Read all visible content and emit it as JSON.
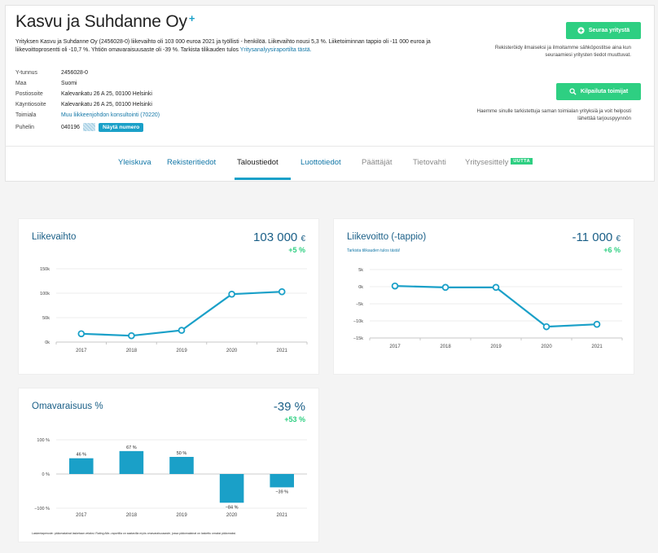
{
  "company": {
    "name": "Kasvu ja Suhdanne Oy",
    "favorite_symbol": "+",
    "description_before_link": "Yrityksen Kasvu ja Suhdanne Oy (2456028-0) liikevaihto oli 103 000 euroa 2021 ja työllisti - henkilöä. Liikevaihto nousi 5,3 %. Liiketoiminnan tappio oli -11 000 euroa ja liikevoittoprosentti oli -10,7 %. Yhtiön omavaraisuusaste oli -39 %. Tarkista tilikauden tulos ",
    "description_link": "Yritysanalyysiraportilta tästä."
  },
  "info": {
    "rows": [
      {
        "key": "Y-tunnus",
        "value": "2456028-0"
      },
      {
        "key": "Maa",
        "value": "Suomi"
      },
      {
        "key": "Postiosoite",
        "value": "Kalevankatu 26 A 25, 00100 Helsinki"
      },
      {
        "key": "Käyntiosoite",
        "value": "Kalevankatu 26 A 25, 00100 Helsinki"
      },
      {
        "key": "Toimiala",
        "value": "Muu liikkeenjohdon konsultointi (70220)"
      }
    ],
    "phone_key": "Puhelin",
    "phone_prefix": "040196",
    "show_number_label": "Näytä numero"
  },
  "actions": {
    "follow_label": "Seuraa yritystä",
    "follow_note": "Rekisteröidy ilmaiseksi ja ilmoitamme sähköpostitse aina kun seuraamiesi yritysten tiedot muuttuvat.",
    "compete_label": "Kilpailuta toimijat",
    "compete_note": "Haemme sinulle tarkistettuja saman toimialan yrityksiä ja voit helposti lähettää tarjouspyynnön"
  },
  "tabs": [
    {
      "label": "Yleiskuva",
      "style": "a"
    },
    {
      "label": "Rekisteritiedot",
      "style": "a"
    },
    {
      "label": "Taloustiedot",
      "style": "active"
    },
    {
      "label": "Luottotiedot",
      "style": "a"
    },
    {
      "label": "Päättäjät",
      "style": "g"
    },
    {
      "label": "Tietovahti",
      "style": "g"
    },
    {
      "label": "Yritysesittely",
      "style": "g"
    }
  ],
  "tab_badge": "UUTTA",
  "colors": {
    "accent": "#1aa0c8",
    "green": "#2ecf82",
    "title_blue": "#1a5f87"
  },
  "chart_data": [
    {
      "type": "line",
      "title": "Liikevaihto",
      "headline_value": "103 000",
      "unit": "€",
      "change": "+5 %",
      "x": [
        "2017",
        "2018",
        "2019",
        "2020",
        "2021"
      ],
      "values": [
        17000,
        13000,
        24000,
        98000,
        103000
      ],
      "ylim": [
        0,
        150000
      ],
      "yticks": [
        0,
        50000,
        100000,
        150000
      ],
      "ytick_labels": [
        "0k",
        "50k",
        "100k",
        "150k"
      ],
      "grid": true
    },
    {
      "type": "line",
      "title": "Liikevoitto (-tappio)",
      "subtitle": "Tarkista tilikauden tulos tästä!",
      "headline_value": "-11 000",
      "unit": "€",
      "change": "+6 %",
      "x": [
        "2017",
        "2018",
        "2019",
        "2020",
        "2021"
      ],
      "values": [
        200,
        -200,
        -200,
        -11700,
        -11000
      ],
      "ylim": [
        -15000,
        5000
      ],
      "yticks": [
        5000,
        0,
        -5000,
        -10000,
        -15000
      ],
      "ytick_labels": [
        "5k",
        "0k",
        "−5k",
        "−10k",
        "−15k"
      ],
      "grid": true
    },
    {
      "type": "bar",
      "title": "Omavaraisuus %",
      "headline_value": "-39 %",
      "change": "+53 %",
      "categories": [
        "2017",
        "2018",
        "2019",
        "2020",
        "2021"
      ],
      "values": [
        46,
        67,
        50,
        -84,
        -39
      ],
      "data_labels": [
        "46 %",
        "67 %",
        "50 %",
        "−84 %",
        "−39 %"
      ],
      "ylim": [
        -100,
        100
      ],
      "yticks": [
        100,
        0,
        -100
      ],
      "ytick_labels": [
        "100 %",
        "0 %",
        "−100 %"
      ],
      "footnote": "Laskentaperuste: pääomalainat lasketaan velaksi. Rating Alfa -raportilla on saatavilla myös omavaraisuusaste, jossa pääomalainat on laskettu omaksi pääomaksi."
    }
  ]
}
